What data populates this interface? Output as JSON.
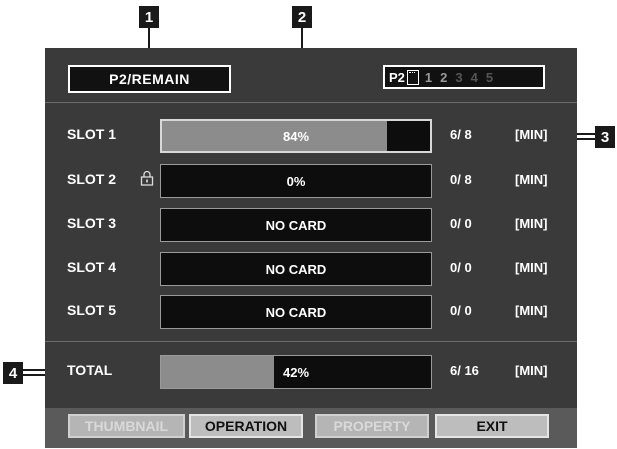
{
  "callouts": {
    "c1": "1",
    "c2": "2",
    "c3": "3",
    "c4": "4"
  },
  "header": {
    "title": "P2/REMAIN",
    "p2_label": "P2",
    "slot_numbers": [
      "1",
      "2",
      "3",
      "4",
      "5"
    ]
  },
  "slots": [
    {
      "label": "SLOT 1",
      "status": "84%",
      "fill": 0.84,
      "count": "6/ 8",
      "unit": "[MIN]"
    },
    {
      "label": "SLOT 2",
      "status": "0%",
      "fill": 0,
      "count": "0/ 8",
      "unit": "[MIN]"
    },
    {
      "label": "SLOT 3",
      "status": "NO CARD",
      "fill": 0,
      "count": "0/ 0",
      "unit": "[MIN]"
    },
    {
      "label": "SLOT 4",
      "status": "NO CARD",
      "fill": 0,
      "count": "0/ 0",
      "unit": "[MIN]"
    },
    {
      "label": "SLOT 5",
      "status": "NO CARD",
      "fill": 0,
      "count": "0/ 0",
      "unit": "[MIN]"
    }
  ],
  "total": {
    "label": "TOTAL",
    "status": "42%",
    "fill": 0.42,
    "count": "6/ 16",
    "unit": "[MIN]"
  },
  "buttons": {
    "thumbnail": "THUMBNAIL",
    "operation": "OPERATION",
    "property": "PROPERTY",
    "exit": "EXIT"
  },
  "colors": {
    "screen_bg": "#3a3a3a",
    "bar_fill": "#8c8c8c",
    "callout_bg": "#1a1a1a"
  }
}
